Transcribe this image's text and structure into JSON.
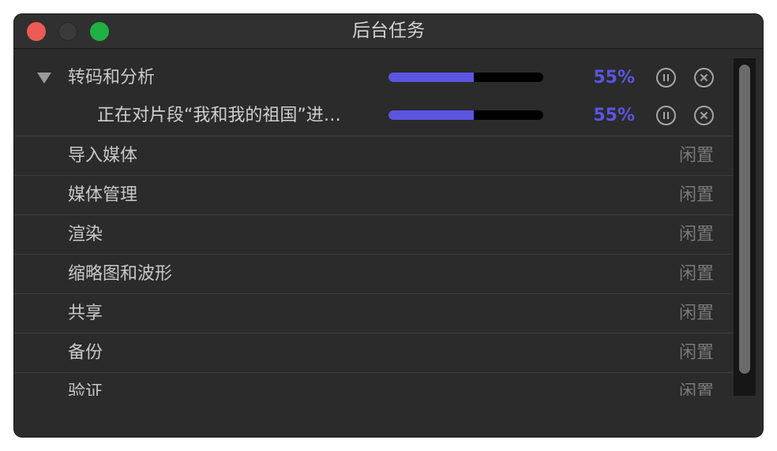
{
  "window": {
    "title": "后台任务"
  },
  "tasks": {
    "group": {
      "label": "转码和分析",
      "progress_fraction": 0.55,
      "percent_text": "55%"
    },
    "subtask": {
      "label": "正在对片段“我和我的祖国”进…",
      "progress_fraction": 0.55,
      "percent_text": "55%"
    },
    "items": [
      {
        "label": "导入媒体",
        "status": "闲置"
      },
      {
        "label": "媒体管理",
        "status": "闲置"
      },
      {
        "label": "渲染",
        "status": "闲置"
      },
      {
        "label": "缩略图和波形",
        "status": "闲置"
      },
      {
        "label": "共享",
        "status": "闲置"
      },
      {
        "label": "备份",
        "status": "闲置"
      },
      {
        "label": "验证",
        "status": "闲置"
      }
    ]
  },
  "colors": {
    "accent": "#5b55e0",
    "close": "#ee5a54",
    "zoom": "#1fb141"
  }
}
